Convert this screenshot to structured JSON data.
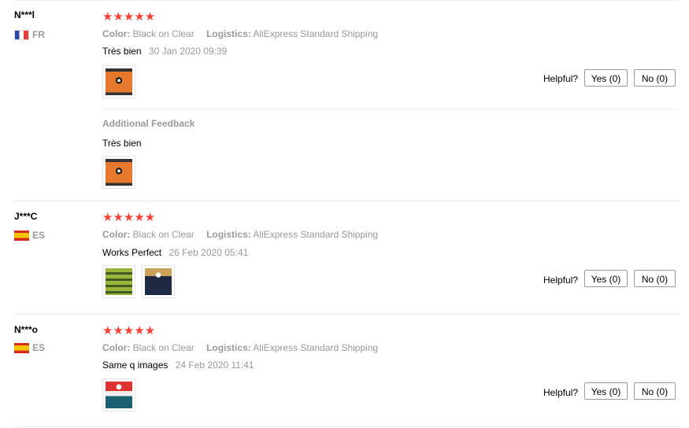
{
  "reviews": [
    {
      "user": "N***l",
      "country": "FR",
      "stars": "★★★★★",
      "color_label": "Color:",
      "color_value": "Black on Clear",
      "logistics_label": "Logistics:",
      "logistics_value": "AliExpress Standard Shipping",
      "text": "Très bien",
      "date": "30 Jan 2020 09:39",
      "helpful_label": "Helpful?",
      "yes_label": "Yes (0)",
      "no_label": "No (0)",
      "additional": {
        "label": "Additional Feedback",
        "text": "Très bien"
      }
    },
    {
      "user": "J***C",
      "country": "ES",
      "stars": "★★★★★",
      "color_label": "Color:",
      "color_value": "Black on Clear",
      "logistics_label": "Logistics:",
      "logistics_value": "AliExpress Standard Shipping",
      "text": "Works Perfect",
      "date": "26 Feb 2020 05:41",
      "helpful_label": "Helpful?",
      "yes_label": "Yes (0)",
      "no_label": "No (0)"
    },
    {
      "user": "N***o",
      "country": "ES",
      "stars": "★★★★★",
      "color_label": "Color:",
      "color_value": "Black on Clear",
      "logistics_label": "Logistics:",
      "logistics_value": "AliExpress Standard Shipping",
      "text": "Same q images",
      "date": "24 Feb 2020 11:41",
      "helpful_label": "Helpful?",
      "yes_label": "Yes (0)",
      "no_label": "No (0)"
    }
  ],
  "rating": {
    "stars": 5,
    "max": 5
  },
  "colors": {
    "star": "#f44336",
    "muted": "#999999"
  }
}
